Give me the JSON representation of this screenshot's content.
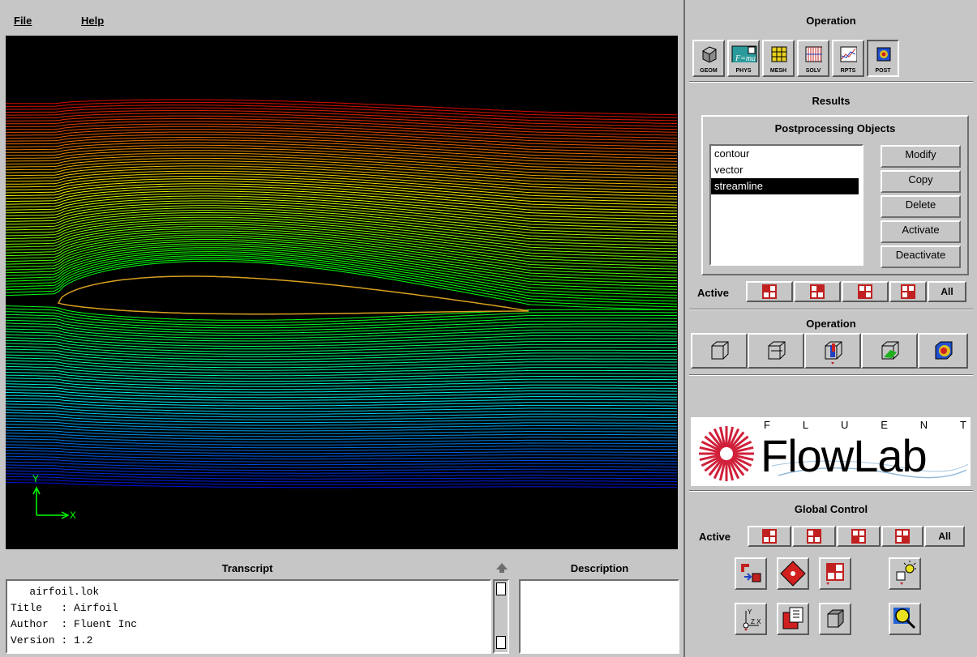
{
  "menu": {
    "file": "File",
    "help": "Help"
  },
  "axes": {
    "y": "Y",
    "x": "X"
  },
  "transcript": {
    "title": "Transcript",
    "lines": [
      "   airfoil.lok",
      "Title   : Airfoil",
      "Author  : Fluent Inc",
      "Version : 1.2"
    ]
  },
  "description": {
    "title": "Description"
  },
  "panel": {
    "operation_title": "Operation",
    "op_buttons": [
      "GEOM",
      "PHYS",
      "MESH",
      "SOLV",
      "RPTS",
      "POST"
    ],
    "results_title": "Results",
    "postproc_title": "Postprocessing Objects",
    "objects": [
      "contour",
      "vector",
      "streamline"
    ],
    "selected_object": "streamline",
    "actions": [
      "Modify",
      "Copy",
      "Delete",
      "Activate",
      "Deactivate"
    ],
    "active_label": "Active",
    "all_label": "All",
    "operation2_title": "Operation",
    "logo_letters": [
      "F",
      "L",
      "U",
      "E",
      "N",
      "T"
    ],
    "logo_name": "FlowLab",
    "global_title": "Global Control",
    "global_active_label": "Active",
    "global_all_label": "All"
  },
  "colors": {
    "airfoil_outline": "#d8a020",
    "axis": "#00ff00",
    "selection": "#000000"
  }
}
